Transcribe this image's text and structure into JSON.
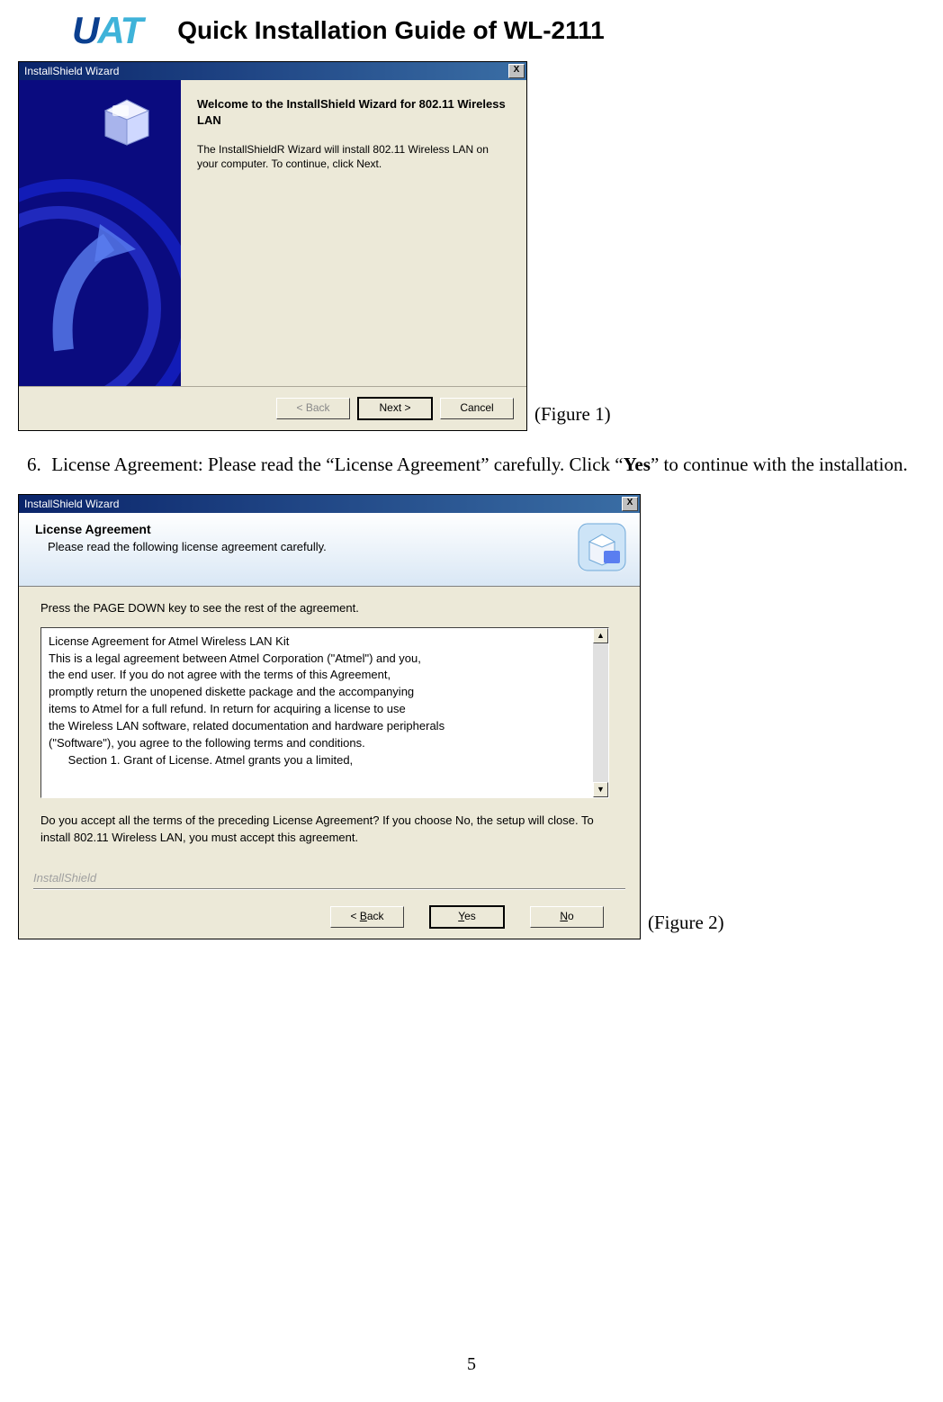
{
  "header": {
    "logo_u": "U",
    "logo_a": "A",
    "logo_t": "T",
    "doc_title": "Quick Installation Guide of WL-2111"
  },
  "figure1": {
    "caption": "(Figure 1)",
    "titlebar": "InstallShield Wizard",
    "close": "X",
    "heading": "Welcome to the InstallShield Wizard for 802.11 Wireless LAN",
    "body": "The InstallShieldR Wizard will install 802.11 Wireless LAN on your computer.  To continue, click Next.",
    "buttons": {
      "back": "< Back",
      "next": "Next >",
      "cancel": "Cancel"
    }
  },
  "instruction6": {
    "num": "6.",
    "pre": "License Agreement: Please read the “License Agreement” carefully.    Click “",
    "bold": "Yes",
    "post": "” to continue with the installation."
  },
  "figure2": {
    "caption": "(Figure 2)",
    "titlebar": "InstallShield Wizard",
    "close": "X",
    "header_title": "License Agreement",
    "header_sub": "Please read the following license agreement carefully.",
    "instr": "Press the PAGE DOWN key to see the rest of the agreement.",
    "license_lines": [
      "License Agreement for Atmel Wireless LAN Kit",
      "",
      "This is a legal agreement between Atmel Corporation (\"Atmel\") and you,",
      "the end user.  If you do not agree with the terms of this Agreement,",
      "promptly return the unopened diskette package and the accompanying",
      "items to Atmel for a full refund.  In return for acquiring a license to use",
      "the Wireless LAN software, related documentation and hardware peripherals",
      "(\"Software\"), you agree to the following terms and conditions.",
      "",
      "      Section 1.  Grant of License.  Atmel grants you a limited,"
    ],
    "accept_text": "Do you accept all the terms of the preceding License Agreement?  If you choose No,  the setup will close.  To install 802.11 Wireless LAN, you must accept this agreement.",
    "brand": "InstallShield",
    "buttons": {
      "back_pre": "< ",
      "back_u": "B",
      "back_post": "ack",
      "yes_u": "Y",
      "yes_post": "es",
      "no_u": "N",
      "no_post": "o"
    }
  },
  "page_number": "5"
}
